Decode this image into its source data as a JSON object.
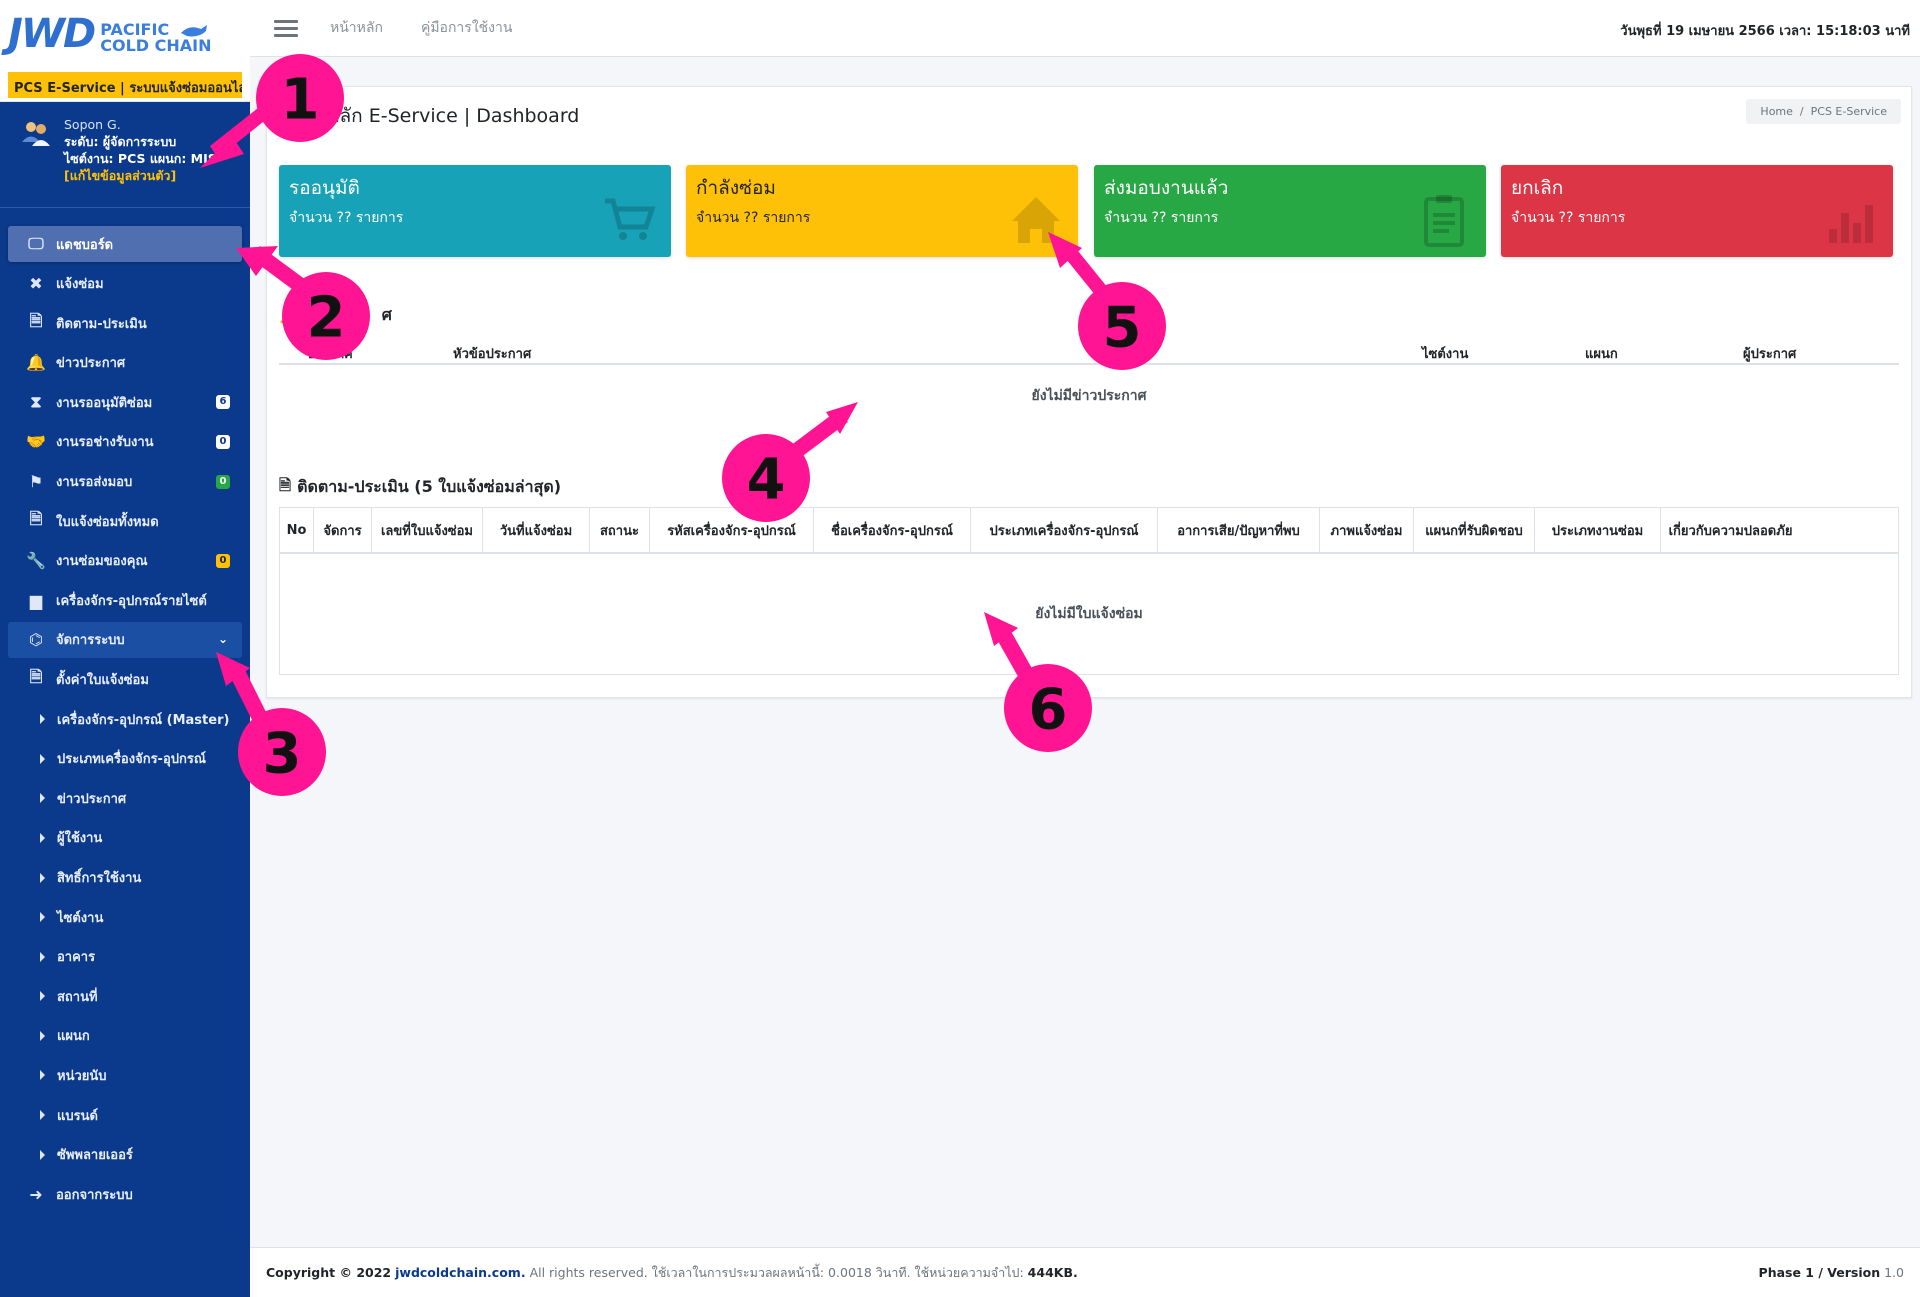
{
  "brand": {
    "logo_main": "JWD",
    "logo_line1": "PACIFIC",
    "logo_line2": "COLD CHAIN",
    "tagline": "PCS E-Service | ระบบแจ้งซ่อมออนไลน์"
  },
  "user": {
    "name": "Sopon G.",
    "role": "ระดับ: ผู้จัดการระบบ",
    "site": "ไซต์งาน: PCS แผนก: MIS",
    "edit": "[แก้ไขข้อมูลส่วนตัว]"
  },
  "nav": [
    {
      "label": "แดชบอร์ด",
      "icon": "monitor-icon",
      "active": true
    },
    {
      "label": "แจ้งซ่อม",
      "icon": "tools-icon"
    },
    {
      "label": "ติดตาม-ประเมิน",
      "icon": "file-icon"
    },
    {
      "label": "ข่าวประกาศ",
      "icon": "bell-icon"
    },
    {
      "label": "งานรออนุมัติซ่อม",
      "icon": "hourglass-icon",
      "badge": "6",
      "badge_color": "white"
    },
    {
      "label": "งานรอช่างรับงาน",
      "icon": "handshake-icon",
      "badge": "0",
      "badge_color": "white"
    },
    {
      "label": "งานรอส่งมอบ",
      "icon": "flag-icon",
      "badge": "0",
      "badge_color": "green"
    },
    {
      "label": "ใบแจ้งซ่อมทั้งหมด",
      "icon": "file-icon"
    },
    {
      "label": "งานซ่อมของคุณ",
      "icon": "wrench-icon",
      "badge": "0",
      "badge_color": "yellow"
    },
    {
      "label": "เครื่องจักร-อุปกรณ์รายไซต์",
      "icon": "factory-icon"
    },
    {
      "label": "จัดการระบบ",
      "icon": "sitemap-icon",
      "parent": true
    },
    {
      "label": "ตั้งค่าใบแจ้งซ่อม",
      "icon": "file-icon"
    },
    {
      "label": "เครื่องจักร-อุปกรณ์ (Master)",
      "sub": true
    },
    {
      "label": "ประเภทเครื่องจักร-อุปกรณ์",
      "sub": true
    },
    {
      "label": "ข่าวประกาศ",
      "sub": true
    },
    {
      "label": "ผู้ใช้งาน",
      "sub": true
    },
    {
      "label": "สิทธิ์การใช้งาน",
      "sub": true
    },
    {
      "label": "ไซต์งาน",
      "sub": true
    },
    {
      "label": "อาคาร",
      "sub": true
    },
    {
      "label": "สถานที่",
      "sub": true
    },
    {
      "label": "แผนก",
      "sub": true
    },
    {
      "label": "หน่วยนับ",
      "sub": true
    },
    {
      "label": "แบรนด์",
      "sub": true
    },
    {
      "label": "ซัพพลายเออร์",
      "sub": true
    },
    {
      "label": "ออกจากระบบ",
      "icon": "logout-icon"
    }
  ],
  "topbar": {
    "home": "หน้าหลัก",
    "manual": "คู่มือการใช้งาน",
    "datetime": "วันพุธที่ 19 เมษายน 2566 เวลา: 15:18:03 นาที"
  },
  "page": {
    "title": "หน้าหลัก E-Service | Dashboard",
    "title_visible": "หลัก E-Service | Dashboard",
    "breadcrumb_home": "Home",
    "breadcrumb_sep": "/",
    "breadcrumb_current": "PCS E-Service"
  },
  "status_boxes": [
    {
      "title": "รออนุมัติ",
      "count": "จำนวน ?? รายการ",
      "color": "#17a2b8",
      "icon": "cart-icon"
    },
    {
      "title": "กำลังซ่อม",
      "count": "จำนวน ?? รายการ",
      "color": "#ffc107",
      "icon": "home-icon"
    },
    {
      "title": "ส่งมอบงานแล้ว",
      "count": "จำนวน ?? รายการ",
      "color": "#28a745",
      "icon": "clipboard-icon"
    },
    {
      "title": "ยกเลิก",
      "count": "จำนวน ?? รายการ",
      "color": "#dc3545",
      "icon": "bar-chart-icon"
    }
  ],
  "news": {
    "title_tail": "ศ",
    "columns": [
      "วันที่ประกาศ",
      "หัวข้อประกาศ",
      "ไซต์งาน",
      "แผนก",
      "ผู้ประกาศ"
    ],
    "col1_visible": "ประกาศ",
    "empty": "ยังไม่มีข่าวประกาศ"
  },
  "tracking": {
    "title": "ติดตาม-ประเมิน (5 ใบแจ้งซ่อมล่าสุด)",
    "columns": [
      "No",
      "จัดการ",
      "เลขที่ใบแจ้งซ่อม",
      "วันที่แจ้งซ่อม",
      "สถานะ",
      "รหัสเครื่องจักร-อุปกรณ์",
      "ชื่อเครื่องจักร-อุปกรณ์",
      "ประเภทเครื่องจักร-อุปกรณ์",
      "อาการเสีย/ปัญหาที่พบ",
      "ภาพแจ้งซ่อม",
      "แผนกที่รับผิดชอบ",
      "ประเภทงานซ่อม",
      "เกี่ยวกับความปลอดภัย"
    ],
    "empty": "ยังไม่มีใบแจ้งซ่อม"
  },
  "footer": {
    "copyright": "Copyright © 2022",
    "site": "jwdcoldchain.com.",
    "rest": "All rights reserved. ใช้เวลาในการประมวลผลหน้านี้: 0.0018 วินาที. ใช้หน่วยความจำไป:",
    "memory": "444KB.",
    "phase": "Phase 1 / Version",
    "version": "1.0"
  },
  "annotations": [
    "1",
    "2",
    "3",
    "4",
    "5",
    "6"
  ],
  "colors": {
    "sidebar": "#0b3a8c",
    "annotation_arrow": "#ff1493",
    "accent": "#ffc107"
  }
}
